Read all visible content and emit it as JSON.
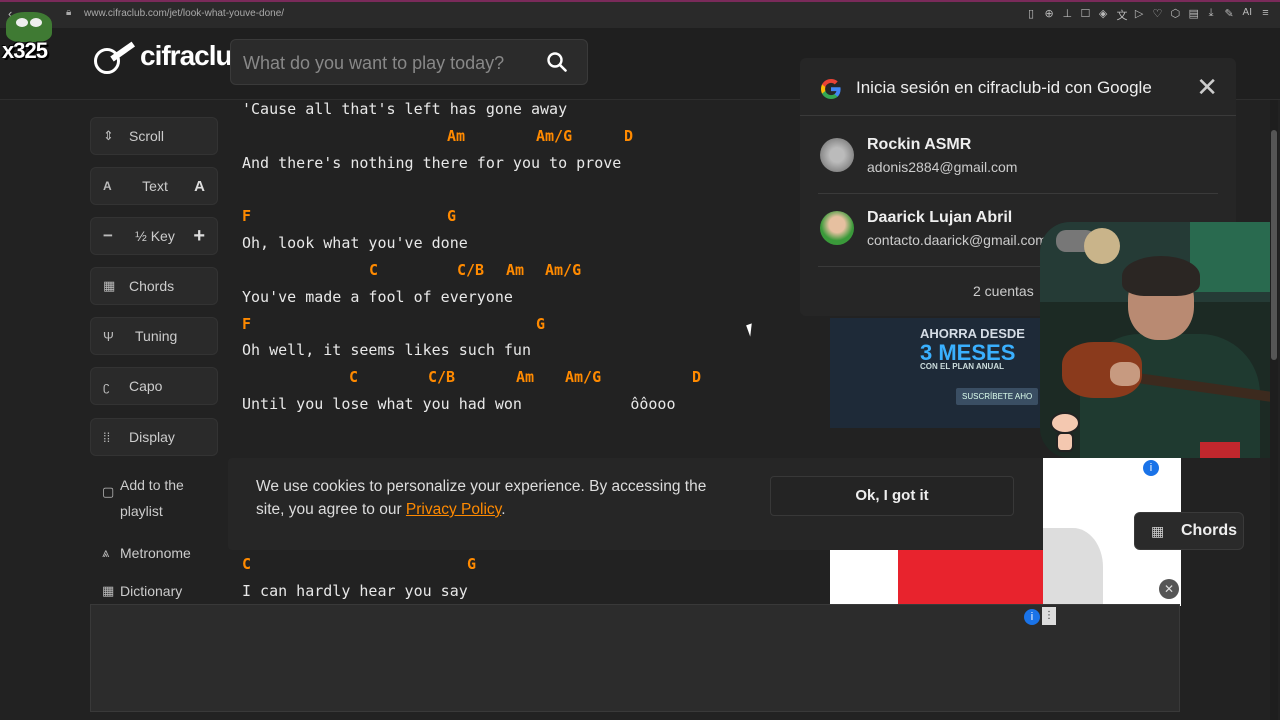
{
  "browser": {
    "url": "www.cifraclub.com/jet/look-what-youve-done/",
    "ai_label": "AI"
  },
  "overlay": {
    "badge": "x325"
  },
  "site": {
    "logo": "cifraclub",
    "search_placeholder": "What do you want to play today?"
  },
  "toolbar": {
    "scroll": "Scroll",
    "text": "Text",
    "text_small": "A",
    "text_big": "A",
    "key_minus": "−",
    "key": "½ Key",
    "key_plus": "+",
    "chords": "Chords",
    "tuning": "Tuning",
    "capo": "Capo",
    "display": "Display",
    "playlist_1": "Add to the",
    "playlist_2": "playlist",
    "metronome": "Metronome",
    "dictionary": "Dictionary"
  },
  "song": {
    "lines": [
      "'Cause all that's left has gone away",
      "And there's nothing there for you to prove",
      "Oh, look what you've done",
      "You've made a fool of everyone",
      "Oh well, it seems likes such fun",
      "Until you lose what you had won            ôôooo",
      "I can hardly hear you say"
    ],
    "chords": {
      "r1": [
        "Am",
        "Am/G",
        "D"
      ],
      "r2": [
        "F",
        "G"
      ],
      "r3": [
        "C",
        "C/B",
        "Am",
        "Am/G"
      ],
      "r4": [
        "F",
        "G"
      ],
      "r5": [
        "C",
        "C/B",
        "Am",
        "Am/G",
        "D"
      ],
      "r6": [
        "C",
        "G"
      ]
    }
  },
  "cookie": {
    "text_before": "We use cookies to personalize your experience. By accessing the site, you agree to our ",
    "link": "Privacy Policy",
    "text_after": ".",
    "button": "Ok, I got it"
  },
  "google_popup": {
    "title": "Inicia sesión en cifraclub-id con Google",
    "accounts": [
      {
        "name": "Rockin ASMR",
        "email": "adonis2884@gmail.com"
      },
      {
        "name": "Daarick Lujan Abril",
        "email": "contacto.daarick@gmail.com"
      }
    ],
    "more": "2 cuentas"
  },
  "ad": {
    "line1": "AHORRA DESDE",
    "line2": "3 MESES",
    "line3": "CON EL PLAN ANUAL",
    "cta": "SUSCRÍBETE AHO"
  },
  "floating_chords": "Chords",
  "colors": {
    "chord": "#ff8a00",
    "accent": "#ff8a00",
    "bg": "#222222"
  }
}
